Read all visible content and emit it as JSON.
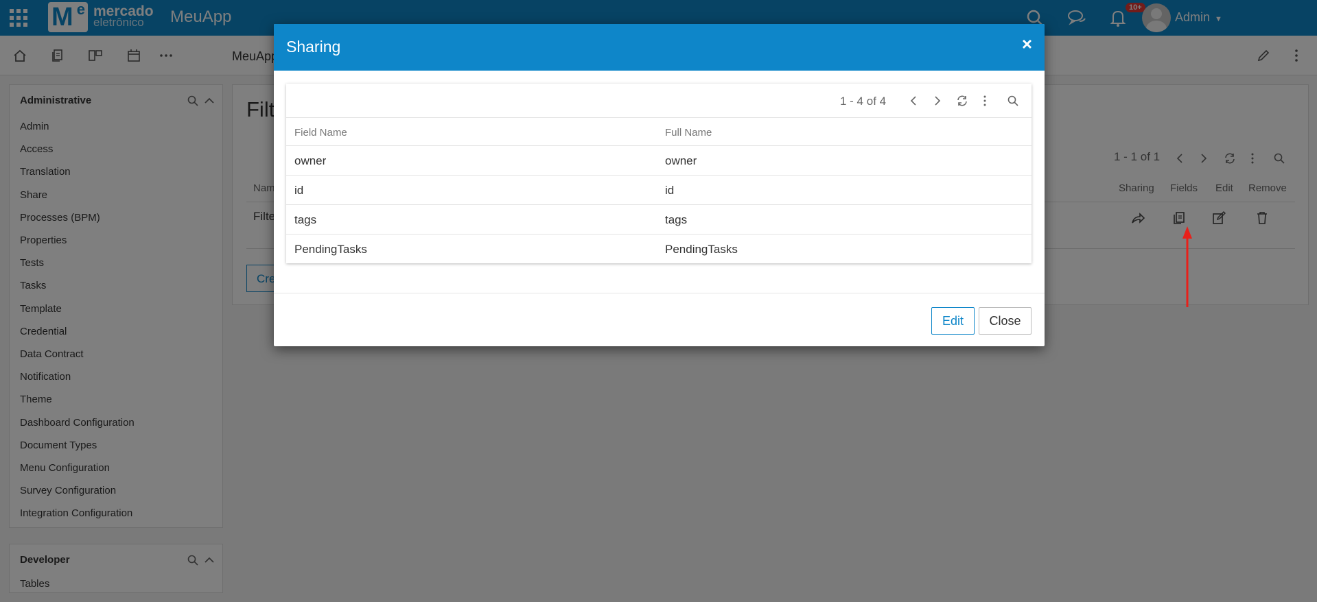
{
  "topbar": {
    "logo_line1": "mercado",
    "logo_line2": "eletrônico",
    "logo_mark": "M",
    "logo_mark_e": "e",
    "app_name": "MeuApp",
    "notification_badge": "10+",
    "user_name": "Admin",
    "icons": [
      "apps-grid-icon",
      "search-icon",
      "chat-icon",
      "bell-icon",
      "user-avatar",
      "caret-down-icon"
    ]
  },
  "toolbar": {
    "breadcrumb": "MeuApp",
    "icons": [
      "home-icon",
      "documents-icon",
      "layout-icon",
      "calendar-icon",
      "more-horizontal-icon",
      "pencil-icon",
      "more-vertical-icon"
    ]
  },
  "sidebar": {
    "admin_section": {
      "title": "Administrative",
      "items": [
        "Admin",
        "Access",
        "Translation",
        "Share",
        "Processes (BPM)",
        "Properties",
        "Tests",
        "Tasks",
        "Template",
        "Credential",
        "Data Contract",
        "Notification",
        "Theme",
        "Dashboard Configuration",
        "Document Types",
        "Menu Configuration",
        "Survey Configuration",
        "Integration Configuration"
      ]
    },
    "developer_section": {
      "title": "Developer",
      "items": [
        "Tables"
      ]
    }
  },
  "main": {
    "title": "Filt",
    "pager": "1 - 1 of 1",
    "columns": {
      "name": "Nam",
      "sharing": "Sharing",
      "fields": "Fields",
      "edit": "Edit",
      "remove": "Remove"
    },
    "row_name": "Filte",
    "create_label": "Cre"
  },
  "modal": {
    "title": "Sharing",
    "close_symbol": "×",
    "pager": "1 - 4 of 4",
    "columns": [
      "Field Name",
      "Full Name"
    ],
    "rows": [
      {
        "field_name": "owner",
        "full_name": "owner"
      },
      {
        "field_name": "id",
        "full_name": "id"
      },
      {
        "field_name": "tags",
        "full_name": "tags"
      },
      {
        "field_name": "PendingTasks",
        "full_name": "PendingTasks"
      }
    ],
    "edit_label": "Edit",
    "close_label": "Close"
  },
  "colors": {
    "primary": "#0e86c9",
    "badge": "#e53935",
    "annotation_arrow": "#e8201a"
  }
}
